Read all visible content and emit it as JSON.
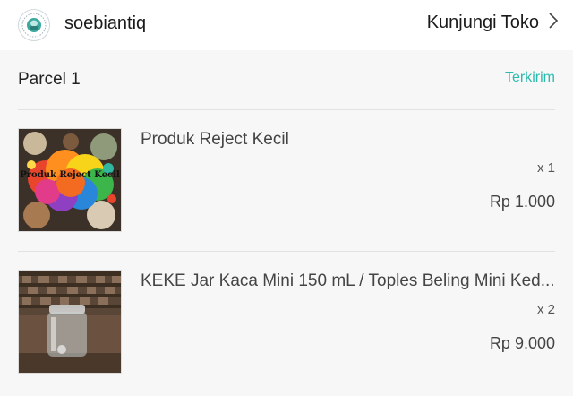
{
  "shop": {
    "name": "soebiantiq",
    "visit_label": "Kunjungi Toko",
    "logo_icon": "shop-logo-icon",
    "chevron_icon": "chevron-right-icon"
  },
  "parcel": {
    "title": "Parcel 1",
    "status": "Terkirim",
    "status_color": "#2bbbad"
  },
  "items": [
    {
      "name": "Produk Reject Kecil",
      "thumb_text": "Produk Reject Kecil",
      "quantity": "x 1",
      "price": "Rp 1.000"
    },
    {
      "name": "KEKE Jar Kaca Mini 150 mL / Toples Beling Mini Ked...",
      "quantity": "x 2",
      "price": "Rp 9.000"
    }
  ]
}
